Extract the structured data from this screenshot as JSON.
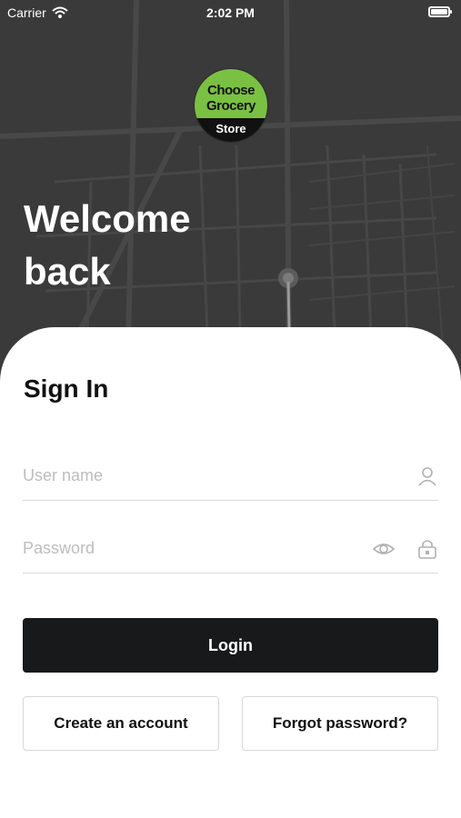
{
  "status_bar": {
    "carrier": "Carrier",
    "time": "2:02 PM",
    "wifi_icon": "wifi-icon",
    "battery_icon": "battery-icon"
  },
  "logo": {
    "line1": "Choose",
    "line2": "Grocery",
    "line3": "Store",
    "brand_green": "#7ac143",
    "band_color": "#111111"
  },
  "hero": {
    "welcome_line1": "Welcome",
    "welcome_line2": "back",
    "background_color": "#3a3a3a"
  },
  "sign_in": {
    "title": "Sign In",
    "username": {
      "placeholder": "User name",
      "value": "",
      "icon": "user-icon"
    },
    "password": {
      "placeholder": "Password",
      "value": "",
      "toggle_icon": "eye-icon",
      "lock_icon": "lock-icon"
    },
    "login_label": "Login",
    "create_account_label": "Create an account",
    "forgot_password_label": "Forgot password?"
  },
  "colors": {
    "primary_button": "#18191b",
    "placeholder": "#bdbdbd",
    "divider": "#dcdcdc"
  }
}
